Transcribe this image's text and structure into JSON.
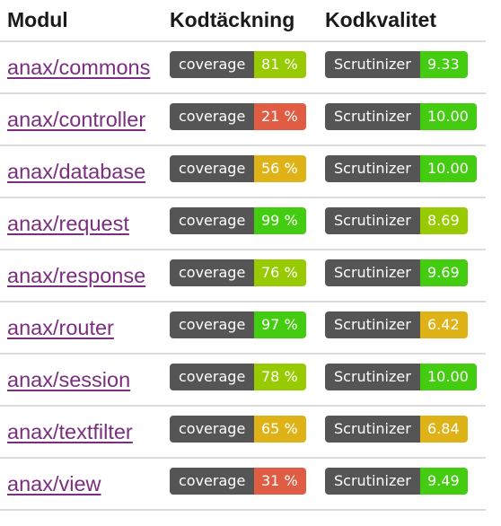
{
  "table": {
    "headers": {
      "module": "Modul",
      "coverage": "Kodtäckning",
      "quality": "Kodkvalitet"
    },
    "badge_labels": {
      "coverage": "coverage",
      "quality": "Scrutinizer"
    },
    "rows": [
      {
        "module": "anax/commons",
        "coverage": "81 %",
        "coverage_color": "#97ca00",
        "quality": "9.33",
        "quality_color": "#44cc11"
      },
      {
        "module": "anax/controller",
        "coverage": "21 %",
        "coverage_color": "#e05d44",
        "quality": "10.00",
        "quality_color": "#44cc11"
      },
      {
        "module": "anax/database",
        "coverage": "56 %",
        "coverage_color": "#dfb317",
        "quality": "10.00",
        "quality_color": "#44cc11"
      },
      {
        "module": "anax/request",
        "coverage": "99 %",
        "coverage_color": "#44cc11",
        "quality": "8.69",
        "quality_color": "#97ca00"
      },
      {
        "module": "anax/response",
        "coverage": "76 %",
        "coverage_color": "#97ca00",
        "quality": "9.69",
        "quality_color": "#44cc11"
      },
      {
        "module": "anax/router",
        "coverage": "97 %",
        "coverage_color": "#44cc11",
        "quality": "6.42",
        "quality_color": "#dfb317"
      },
      {
        "module": "anax/session",
        "coverage": "78 %",
        "coverage_color": "#97ca00",
        "quality": "10.00",
        "quality_color": "#44cc11"
      },
      {
        "module": "anax/textfilter",
        "coverage": "65 %",
        "coverage_color": "#dfb317",
        "quality": "6.84",
        "quality_color": "#dfb317"
      },
      {
        "module": "anax/view",
        "coverage": "31 %",
        "coverage_color": "#e05d44",
        "quality": "9.49",
        "quality_color": "#44cc11"
      }
    ]
  }
}
